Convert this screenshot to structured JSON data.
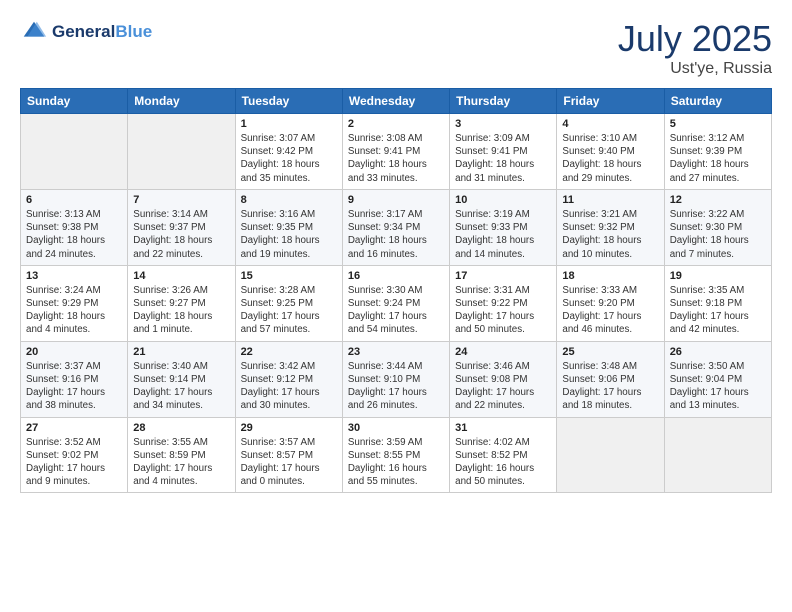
{
  "header": {
    "logo_line1": "General",
    "logo_line2": "Blue",
    "main_title": "July 2025",
    "subtitle": "Ust'ye, Russia"
  },
  "columns": [
    "Sunday",
    "Monday",
    "Tuesday",
    "Wednesday",
    "Thursday",
    "Friday",
    "Saturday"
  ],
  "weeks": [
    [
      {
        "day": "",
        "info": ""
      },
      {
        "day": "",
        "info": ""
      },
      {
        "day": "1",
        "info": "Sunrise: 3:07 AM\nSunset: 9:42 PM\nDaylight: 18 hours and 35 minutes."
      },
      {
        "day": "2",
        "info": "Sunrise: 3:08 AM\nSunset: 9:41 PM\nDaylight: 18 hours and 33 minutes."
      },
      {
        "day": "3",
        "info": "Sunrise: 3:09 AM\nSunset: 9:41 PM\nDaylight: 18 hours and 31 minutes."
      },
      {
        "day": "4",
        "info": "Sunrise: 3:10 AM\nSunset: 9:40 PM\nDaylight: 18 hours and 29 minutes."
      },
      {
        "day": "5",
        "info": "Sunrise: 3:12 AM\nSunset: 9:39 PM\nDaylight: 18 hours and 27 minutes."
      }
    ],
    [
      {
        "day": "6",
        "info": "Sunrise: 3:13 AM\nSunset: 9:38 PM\nDaylight: 18 hours and 24 minutes."
      },
      {
        "day": "7",
        "info": "Sunrise: 3:14 AM\nSunset: 9:37 PM\nDaylight: 18 hours and 22 minutes."
      },
      {
        "day": "8",
        "info": "Sunrise: 3:16 AM\nSunset: 9:35 PM\nDaylight: 18 hours and 19 minutes."
      },
      {
        "day": "9",
        "info": "Sunrise: 3:17 AM\nSunset: 9:34 PM\nDaylight: 18 hours and 16 minutes."
      },
      {
        "day": "10",
        "info": "Sunrise: 3:19 AM\nSunset: 9:33 PM\nDaylight: 18 hours and 14 minutes."
      },
      {
        "day": "11",
        "info": "Sunrise: 3:21 AM\nSunset: 9:32 PM\nDaylight: 18 hours and 10 minutes."
      },
      {
        "day": "12",
        "info": "Sunrise: 3:22 AM\nSunset: 9:30 PM\nDaylight: 18 hours and 7 minutes."
      }
    ],
    [
      {
        "day": "13",
        "info": "Sunrise: 3:24 AM\nSunset: 9:29 PM\nDaylight: 18 hours and 4 minutes."
      },
      {
        "day": "14",
        "info": "Sunrise: 3:26 AM\nSunset: 9:27 PM\nDaylight: 18 hours and 1 minute."
      },
      {
        "day": "15",
        "info": "Sunrise: 3:28 AM\nSunset: 9:25 PM\nDaylight: 17 hours and 57 minutes."
      },
      {
        "day": "16",
        "info": "Sunrise: 3:30 AM\nSunset: 9:24 PM\nDaylight: 17 hours and 54 minutes."
      },
      {
        "day": "17",
        "info": "Sunrise: 3:31 AM\nSunset: 9:22 PM\nDaylight: 17 hours and 50 minutes."
      },
      {
        "day": "18",
        "info": "Sunrise: 3:33 AM\nSunset: 9:20 PM\nDaylight: 17 hours and 46 minutes."
      },
      {
        "day": "19",
        "info": "Sunrise: 3:35 AM\nSunset: 9:18 PM\nDaylight: 17 hours and 42 minutes."
      }
    ],
    [
      {
        "day": "20",
        "info": "Sunrise: 3:37 AM\nSunset: 9:16 PM\nDaylight: 17 hours and 38 minutes."
      },
      {
        "day": "21",
        "info": "Sunrise: 3:40 AM\nSunset: 9:14 PM\nDaylight: 17 hours and 34 minutes."
      },
      {
        "day": "22",
        "info": "Sunrise: 3:42 AM\nSunset: 9:12 PM\nDaylight: 17 hours and 30 minutes."
      },
      {
        "day": "23",
        "info": "Sunrise: 3:44 AM\nSunset: 9:10 PM\nDaylight: 17 hours and 26 minutes."
      },
      {
        "day": "24",
        "info": "Sunrise: 3:46 AM\nSunset: 9:08 PM\nDaylight: 17 hours and 22 minutes."
      },
      {
        "day": "25",
        "info": "Sunrise: 3:48 AM\nSunset: 9:06 PM\nDaylight: 17 hours and 18 minutes."
      },
      {
        "day": "26",
        "info": "Sunrise: 3:50 AM\nSunset: 9:04 PM\nDaylight: 17 hours and 13 minutes."
      }
    ],
    [
      {
        "day": "27",
        "info": "Sunrise: 3:52 AM\nSunset: 9:02 PM\nDaylight: 17 hours and 9 minutes."
      },
      {
        "day": "28",
        "info": "Sunrise: 3:55 AM\nSunset: 8:59 PM\nDaylight: 17 hours and 4 minutes."
      },
      {
        "day": "29",
        "info": "Sunrise: 3:57 AM\nSunset: 8:57 PM\nDaylight: 17 hours and 0 minutes."
      },
      {
        "day": "30",
        "info": "Sunrise: 3:59 AM\nSunset: 8:55 PM\nDaylight: 16 hours and 55 minutes."
      },
      {
        "day": "31",
        "info": "Sunrise: 4:02 AM\nSunset: 8:52 PM\nDaylight: 16 hours and 50 minutes."
      },
      {
        "day": "",
        "info": ""
      },
      {
        "day": "",
        "info": ""
      }
    ]
  ]
}
